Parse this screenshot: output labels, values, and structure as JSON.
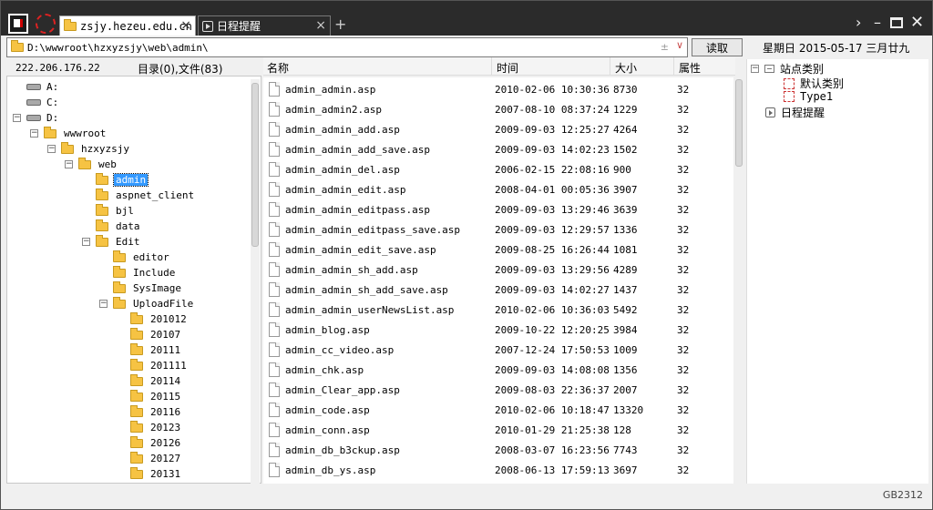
{
  "tabs": [
    {
      "label": "zsjy.hezeu.edu.cn",
      "icon": "folder-icon",
      "active": true
    },
    {
      "label": "日程提醒",
      "icon": "calendar-icon",
      "active": false
    }
  ],
  "new_tab_label": "+",
  "address": {
    "path": "D:\\wwwroot\\hzxyzsjy\\web\\admin\\",
    "pm": "± ",
    "dropdown": "∨"
  },
  "read_button": "读取",
  "date": "星期日 2015-05-17 三月廿九",
  "server_ip": "222.206.176.22",
  "dir_counts": "目录(0),文件(83)",
  "tree": [
    {
      "label": "A:",
      "kind": "drive",
      "level": 0,
      "expander": ""
    },
    {
      "label": "C:",
      "kind": "drive",
      "level": 0,
      "expander": ""
    },
    {
      "label": "D:",
      "kind": "drive",
      "level": 0,
      "expander": "−"
    },
    {
      "label": "wwwroot",
      "kind": "folder",
      "level": 1,
      "expander": "−"
    },
    {
      "label": "hzxyzsjy",
      "kind": "folder",
      "level": 2,
      "expander": "−"
    },
    {
      "label": "web",
      "kind": "folder",
      "level": 3,
      "expander": "−"
    },
    {
      "label": "admin",
      "kind": "folder",
      "level": 4,
      "expander": "",
      "selected": true
    },
    {
      "label": "aspnet_client",
      "kind": "folder",
      "level": 4,
      "expander": ""
    },
    {
      "label": "bjl",
      "kind": "folder",
      "level": 4,
      "expander": ""
    },
    {
      "label": "data",
      "kind": "folder",
      "level": 4,
      "expander": ""
    },
    {
      "label": "Edit",
      "kind": "folder",
      "level": 4,
      "expander": "−"
    },
    {
      "label": "editor",
      "kind": "folder",
      "level": 5,
      "expander": ""
    },
    {
      "label": "Include",
      "kind": "folder",
      "level": 5,
      "expander": ""
    },
    {
      "label": "SysImage",
      "kind": "folder",
      "level": 5,
      "expander": ""
    },
    {
      "label": "UploadFile",
      "kind": "folder",
      "level": 5,
      "expander": "−"
    },
    {
      "label": "201012",
      "kind": "folder",
      "level": 6,
      "expander": ""
    },
    {
      "label": "20107",
      "kind": "folder",
      "level": 6,
      "expander": ""
    },
    {
      "label": "20111",
      "kind": "folder",
      "level": 6,
      "expander": ""
    },
    {
      "label": "201111",
      "kind": "folder",
      "level": 6,
      "expander": ""
    },
    {
      "label": "20114",
      "kind": "folder",
      "level": 6,
      "expander": ""
    },
    {
      "label": "20115",
      "kind": "folder",
      "level": 6,
      "expander": ""
    },
    {
      "label": "20116",
      "kind": "folder",
      "level": 6,
      "expander": ""
    },
    {
      "label": "20123",
      "kind": "folder",
      "level": 6,
      "expander": ""
    },
    {
      "label": "20126",
      "kind": "folder",
      "level": 6,
      "expander": ""
    },
    {
      "label": "20127",
      "kind": "folder",
      "level": 6,
      "expander": ""
    },
    {
      "label": "20131",
      "kind": "folder",
      "level": 6,
      "expander": ""
    }
  ],
  "columns": {
    "name": "名称",
    "time": "时间",
    "size": "大小",
    "attr": "属性"
  },
  "files": [
    {
      "name": "admin_admin.asp",
      "time": "2010-02-06 10:30:36",
      "size": "8730",
      "attr": "32"
    },
    {
      "name": "admin_admin2.asp",
      "time": "2007-08-10 08:37:24",
      "size": "1229",
      "attr": "32"
    },
    {
      "name": "admin_admin_add.asp",
      "time": "2009-09-03 12:25:27",
      "size": "4264",
      "attr": "32"
    },
    {
      "name": "admin_admin_add_save.asp",
      "time": "2009-09-03 14:02:23",
      "size": "1502",
      "attr": "32"
    },
    {
      "name": "admin_admin_del.asp",
      "time": "2006-02-15 22:08:16",
      "size": "900",
      "attr": "32"
    },
    {
      "name": "admin_admin_edit.asp",
      "time": "2008-04-01 00:05:36",
      "size": "3907",
      "attr": "32"
    },
    {
      "name": "admin_admin_editpass.asp",
      "time": "2009-09-03 13:29:46",
      "size": "3639",
      "attr": "32"
    },
    {
      "name": "admin_admin_editpass_save.asp",
      "time": "2009-09-03 12:29:57",
      "size": "1336",
      "attr": "32"
    },
    {
      "name": "admin_admin_edit_save.asp",
      "time": "2009-08-25 16:26:44",
      "size": "1081",
      "attr": "32"
    },
    {
      "name": "admin_admin_sh_add.asp",
      "time": "2009-09-03 13:29:56",
      "size": "4289",
      "attr": "32"
    },
    {
      "name": "admin_admin_sh_add_save.asp",
      "time": "2009-09-03 14:02:27",
      "size": "1437",
      "attr": "32"
    },
    {
      "name": "admin_admin_userNewsList.asp",
      "time": "2010-02-06 10:36:03",
      "size": "5492",
      "attr": "32"
    },
    {
      "name": "admin_blog.asp",
      "time": "2009-10-22 12:20:25",
      "size": "3984",
      "attr": "32"
    },
    {
      "name": "admin_cc_video.asp",
      "time": "2007-12-24 17:50:53",
      "size": "1009",
      "attr": "32"
    },
    {
      "name": "admin_chk.asp",
      "time": "2009-09-03 14:08:08",
      "size": "1356",
      "attr": "32"
    },
    {
      "name": "admin_Clear_app.asp",
      "time": "2009-08-03 22:36:37",
      "size": "2007",
      "attr": "32"
    },
    {
      "name": "admin_code.asp",
      "time": "2010-02-06 10:18:47",
      "size": "13320",
      "attr": "32"
    },
    {
      "name": "admin_conn.asp",
      "time": "2010-01-29 21:25:38",
      "size": "128",
      "attr": "32"
    },
    {
      "name": "admin_db_b3ckup.asp",
      "time": "2008-03-07 16:23:56",
      "size": "7743",
      "attr": "32"
    },
    {
      "name": "admin_db_ys.asp",
      "time": "2008-06-13 17:59:13",
      "size": "3697",
      "attr": "32"
    }
  ],
  "right_panel": {
    "root_label": "站点类别",
    "items": [
      {
        "label": "默认类别",
        "icon": "category-icon"
      },
      {
        "label": "Type1",
        "icon": "category-icon"
      }
    ],
    "schedule_label": "日程提醒"
  },
  "encoding": "GB2312"
}
